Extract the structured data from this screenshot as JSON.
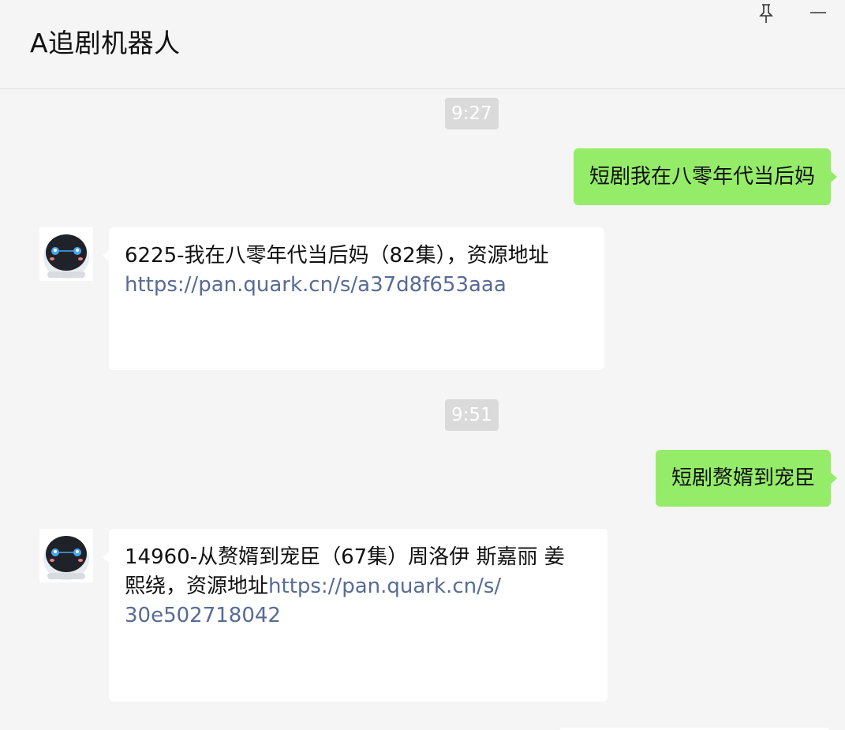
{
  "window": {
    "title": "A追剧机器人",
    "pin_icon": "pin-icon",
    "minimize_icon": "minimize-icon"
  },
  "messages": [
    {
      "type": "time",
      "text": "9:27"
    },
    {
      "type": "outgoing",
      "text": "短剧我在八零年代当后妈"
    },
    {
      "type": "incoming",
      "avatar": "robot-avatar",
      "lines": [
        "6225-我在八零年代当后妈（82集），资源地址"
      ],
      "link_lines": [
        "https://pan.quark.cn/s/a37d8f653aaa"
      ]
    },
    {
      "type": "time",
      "text": "9:51"
    },
    {
      "type": "outgoing",
      "text": "短剧赘婿到宠臣"
    },
    {
      "type": "incoming",
      "avatar": "robot-avatar",
      "line1": "14960-从赘婿到宠臣（67集）周洛伊 斯嘉丽 姜",
      "line2_text": "熙绕，资源地址",
      "line2_link": "https://pan.quark.cn/s/",
      "line3_link": "30e502718042"
    }
  ],
  "colors": {
    "background": "#f5f5f5",
    "outgoing_bubble": "#95ec69",
    "incoming_bubble": "#ffffff",
    "link": "#576b95",
    "time_badge": "#dadada"
  }
}
